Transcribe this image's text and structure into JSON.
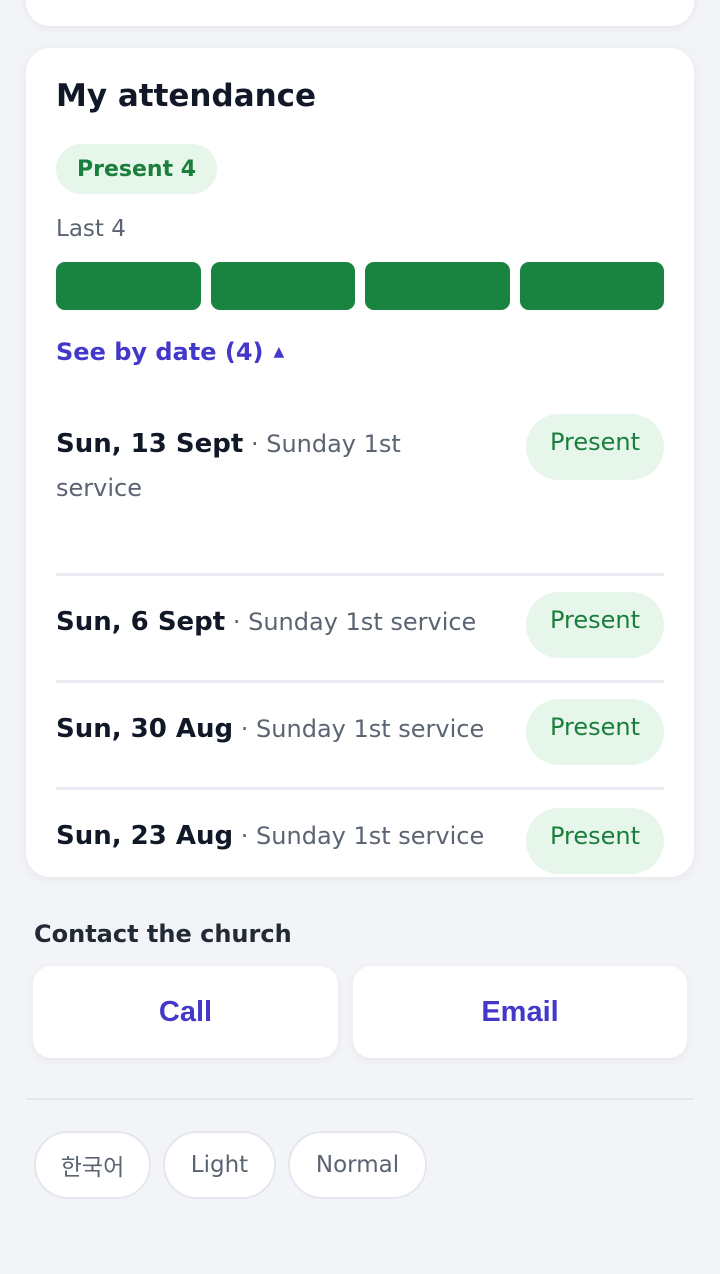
{
  "attendance": {
    "title": "My attendance",
    "summary_badge": "Present 4",
    "last_label": "Last 4",
    "bars": [
      {
        "status": "present",
        "color": "#198440"
      },
      {
        "status": "present",
        "color": "#198440"
      },
      {
        "status": "present",
        "color": "#198440"
      },
      {
        "status": "present",
        "color": "#198440"
      }
    ],
    "see_by_date": "See by date (4)",
    "records": [
      {
        "date": "Sun, 13 Sept",
        "separator": " · ",
        "service": "Sunday 1st service",
        "status": "Present"
      },
      {
        "date": "Sun, 6 Sept",
        "separator": " · ",
        "service": "Sunday 1st service",
        "status": "Present"
      },
      {
        "date": "Sun, 30 Aug",
        "separator": " · ",
        "service": "Sunday 1st service",
        "status": "Present"
      },
      {
        "date": "Sun, 23 Aug",
        "separator": " · ",
        "service": "Sunday 1st service",
        "status": "Present"
      }
    ]
  },
  "contact": {
    "title": "Contact the church",
    "call_label": "Call",
    "email_label": "Email"
  },
  "footer": {
    "language": "한국어",
    "theme": "Light",
    "text_size": "Normal"
  },
  "colors": {
    "accent": "#4338ca",
    "present_green": "#198440",
    "present_bg": "#e6f6ea"
  }
}
